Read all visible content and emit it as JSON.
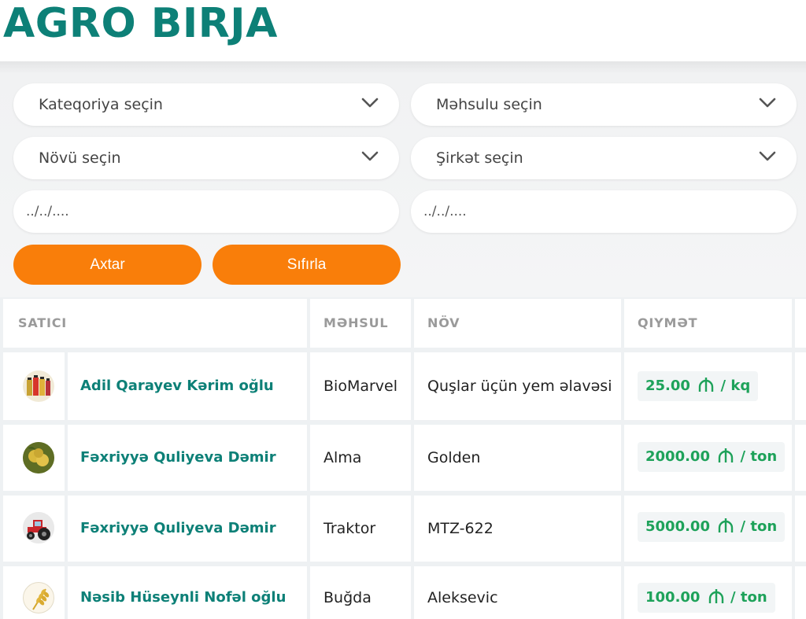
{
  "header": {
    "logo": "AGRO BIRJA"
  },
  "filters": {
    "category_placeholder": "Kateqoriya seçin",
    "product_placeholder": "Məhsulu seçin",
    "type_placeholder": "Növü seçin",
    "company_placeholder": "Şirkət seçin",
    "date_from_placeholder": "../../....",
    "date_to_placeholder": "../../....",
    "search_label": "Axtar",
    "reset_label": "Sıfırla"
  },
  "table": {
    "headers": {
      "seller": "SATICI",
      "product": "MƏHSUL",
      "type": "NÖV",
      "price": "QIYMƏT"
    },
    "rows": [
      {
        "seller": "Adil Qarayev Kərim oğlu",
        "product": "BioMarvel",
        "type": "Quşlar üçün yem əlavəsi",
        "price": "25.00",
        "unit": "kq",
        "avatar": "bottles-icon"
      },
      {
        "seller": "Fəxriyyə Quliyeva Dəmir qızı",
        "product": "Alma",
        "type": "Golden",
        "price": "2000.00",
        "unit": "ton",
        "avatar": "apple-icon"
      },
      {
        "seller": "Fəxriyyə Quliyeva Dəmir qızı",
        "product": "Traktor",
        "type": "MTZ-622",
        "price": "5000.00",
        "unit": "ton",
        "avatar": "tractor-icon"
      },
      {
        "seller": "Nəsib Hüseynli Nofəl oğlu",
        "product": "Buğda",
        "type": "Aleksevic",
        "price": "100.00",
        "unit": "ton",
        "avatar": "wheat-icon"
      }
    ]
  },
  "colors": {
    "brand": "#0d8077",
    "accent": "#f97e0a",
    "price": "#1ea25a"
  }
}
